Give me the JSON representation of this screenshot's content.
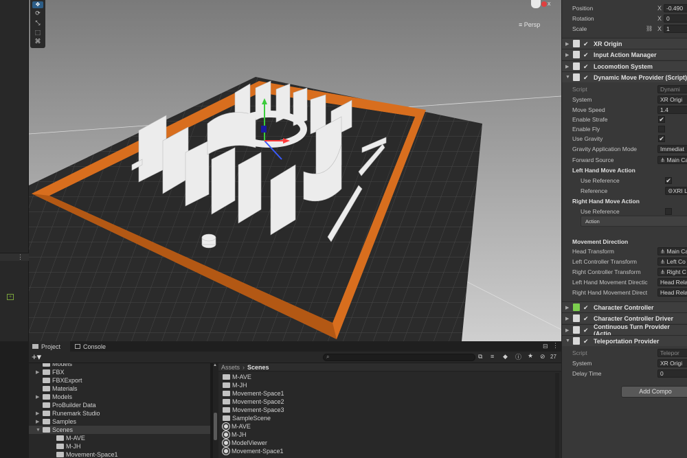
{
  "inspector": {
    "transform": [
      {
        "label": "Position",
        "axis": "X",
        "value": "-0.490"
      },
      {
        "label": "Rotation",
        "axis": "X",
        "value": "0"
      },
      {
        "label": "Scale",
        "axis": "X",
        "value": "1"
      }
    ],
    "components_top": [
      {
        "name": "XR Origin",
        "arrow": "▶"
      },
      {
        "name": "Input Action Manager",
        "arrow": "▶"
      },
      {
        "name": "Locomotion System",
        "arrow": "▶"
      },
      {
        "name": "Dynamic Move Provider (Script)",
        "arrow": "▼"
      }
    ],
    "dmp_fields": {
      "script_label": "Script",
      "script_value": "Dynami",
      "system_label": "System",
      "system_value": "XR Origi",
      "move_speed_label": "Move Speed",
      "move_speed_value": "1.4",
      "enable_strafe_label": "Enable Strafe",
      "enable_strafe": "✔",
      "enable_fly_label": "Enable Fly",
      "use_gravity_label": "Use Gravity",
      "use_gravity": "✔",
      "gravity_mode_label": "Gravity Application Mode",
      "gravity_mode_value": "Immediat",
      "forward_source_label": "Forward Source",
      "forward_source_value": "Main Ca",
      "left_hand_header": "Left Hand Move Action",
      "left_use_ref_label": "Use Reference",
      "left_use_ref": "✔",
      "left_ref_label": "Reference",
      "left_ref_value": "XRI L",
      "right_hand_header": "Right Hand Move Action",
      "right_use_ref_label": "Use Reference",
      "action_label": "Action",
      "movement_direction_header": "Movement Direction",
      "head_transform_label": "Head Transform",
      "head_transform_value": "Main Ca",
      "left_ctrl_label": "Left Controller Transform",
      "left_ctrl_value": "Left Co",
      "right_ctrl_label": "Right Controller Transform",
      "right_ctrl_value": "Right C",
      "left_dir_label": "Left Hand Movement Directic",
      "left_dir_value": "Head Rela",
      "right_dir_label": "Right Hand Movement Direct",
      "right_dir_value": "Head Rela"
    },
    "components_bottom": [
      {
        "name": "Character Controller",
        "arrow": "▶"
      },
      {
        "name": "Character Controller Driver",
        "arrow": "▶"
      },
      {
        "name": "Continuous Turn Provider (Actio",
        "arrow": "▶"
      },
      {
        "name": "Teleportation Provider",
        "arrow": "▼"
      }
    ],
    "tp_fields": {
      "script_label": "Script",
      "script_value": "Telepor",
      "system_label": "System",
      "system_value": "XR Origi",
      "delay_label": "Delay Time",
      "delay_value": "0"
    },
    "add_component": "Add Compo"
  },
  "scene_view": {
    "persp_label": "Persp",
    "gizmo_x": "x",
    "tool_icons": [
      "move-icon",
      "rotate-icon",
      "scale-icon",
      "rect-icon",
      "transform-icon"
    ]
  },
  "project": {
    "tabs": [
      "Project",
      "Console"
    ],
    "breadcrumb": [
      "Assets",
      "Scenes"
    ],
    "search_placeholder": "",
    "hidden_count": "27",
    "tree": [
      {
        "label": "Models",
        "indent": 1,
        "arrow": ""
      },
      {
        "label": "FBX",
        "indent": 1,
        "arrow": "▶"
      },
      {
        "label": "FBXExport",
        "indent": 1,
        "arrow": ""
      },
      {
        "label": "Materials",
        "indent": 1,
        "arrow": ""
      },
      {
        "label": "Models",
        "indent": 1,
        "arrow": "▶"
      },
      {
        "label": "ProBuilder Data",
        "indent": 1,
        "arrow": ""
      },
      {
        "label": "Runemark Studio",
        "indent": 1,
        "arrow": "▶"
      },
      {
        "label": "Samples",
        "indent": 1,
        "arrow": "▶"
      },
      {
        "label": "Scenes",
        "indent": 1,
        "arrow": "▼"
      },
      {
        "label": "M-AVE",
        "indent": 2,
        "arrow": ""
      },
      {
        "label": "M-JH",
        "indent": 2,
        "arrow": ""
      },
      {
        "label": "Movement-Space1",
        "indent": 2,
        "arrow": ""
      }
    ],
    "files": [
      {
        "label": "M-AVE",
        "type": "folder"
      },
      {
        "label": "M-JH",
        "type": "folder"
      },
      {
        "label": "Movement-Space1",
        "type": "folder"
      },
      {
        "label": "Movement-Space2",
        "type": "folder"
      },
      {
        "label": "Movement-Space3",
        "type": "folder"
      },
      {
        "label": "SampleScene",
        "type": "folder"
      },
      {
        "label": "M-AVE",
        "type": "scene"
      },
      {
        "label": "M-JH",
        "type": "scene"
      },
      {
        "label": "ModelViewer",
        "type": "scene"
      },
      {
        "label": "Movement-Space1",
        "type": "scene"
      }
    ]
  },
  "colors": {
    "accent_blue": "#2c5d87",
    "orange_wall": "#d86e1e",
    "floor": "#2a2a2a"
  }
}
